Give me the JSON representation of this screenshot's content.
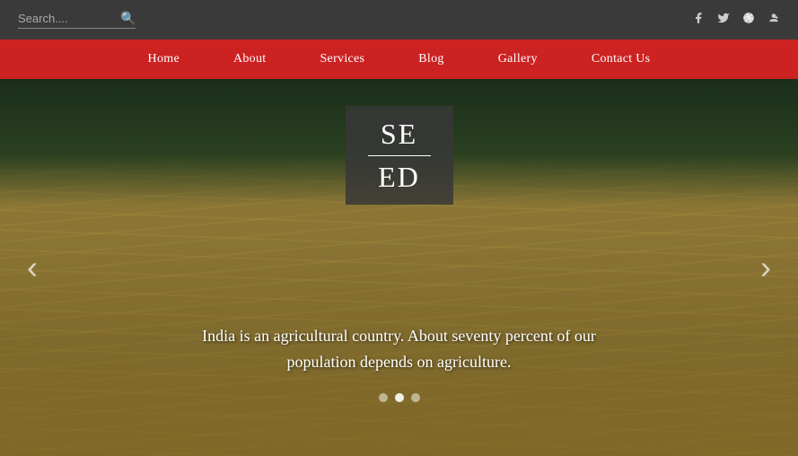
{
  "topbar": {
    "search_placeholder": "Search....",
    "search_icon": "🔍"
  },
  "social": {
    "icons": [
      {
        "name": "facebook-icon",
        "symbol": "f"
      },
      {
        "name": "twitter-icon",
        "symbol": "t"
      },
      {
        "name": "dribbble-icon",
        "symbol": "d"
      },
      {
        "name": "google-plus-icon",
        "symbol": "g+"
      }
    ]
  },
  "nav": {
    "items": [
      {
        "label": "Home",
        "name": "nav-home"
      },
      {
        "label": "About",
        "name": "nav-about"
      },
      {
        "label": "Services",
        "name": "nav-services"
      },
      {
        "label": "Blog",
        "name": "nav-blog"
      },
      {
        "label": "Gallery",
        "name": "nav-gallery"
      },
      {
        "label": "Contact Us",
        "name": "nav-contact"
      }
    ]
  },
  "logo": {
    "line1": "SE",
    "line2": "ED"
  },
  "hero": {
    "slide_text": "India is an agricultural country. About seventy percent of our population depends on agriculture.",
    "prev_label": "‹",
    "next_label": "›",
    "dots": [
      {
        "active": false
      },
      {
        "active": true
      },
      {
        "active": false
      }
    ]
  }
}
